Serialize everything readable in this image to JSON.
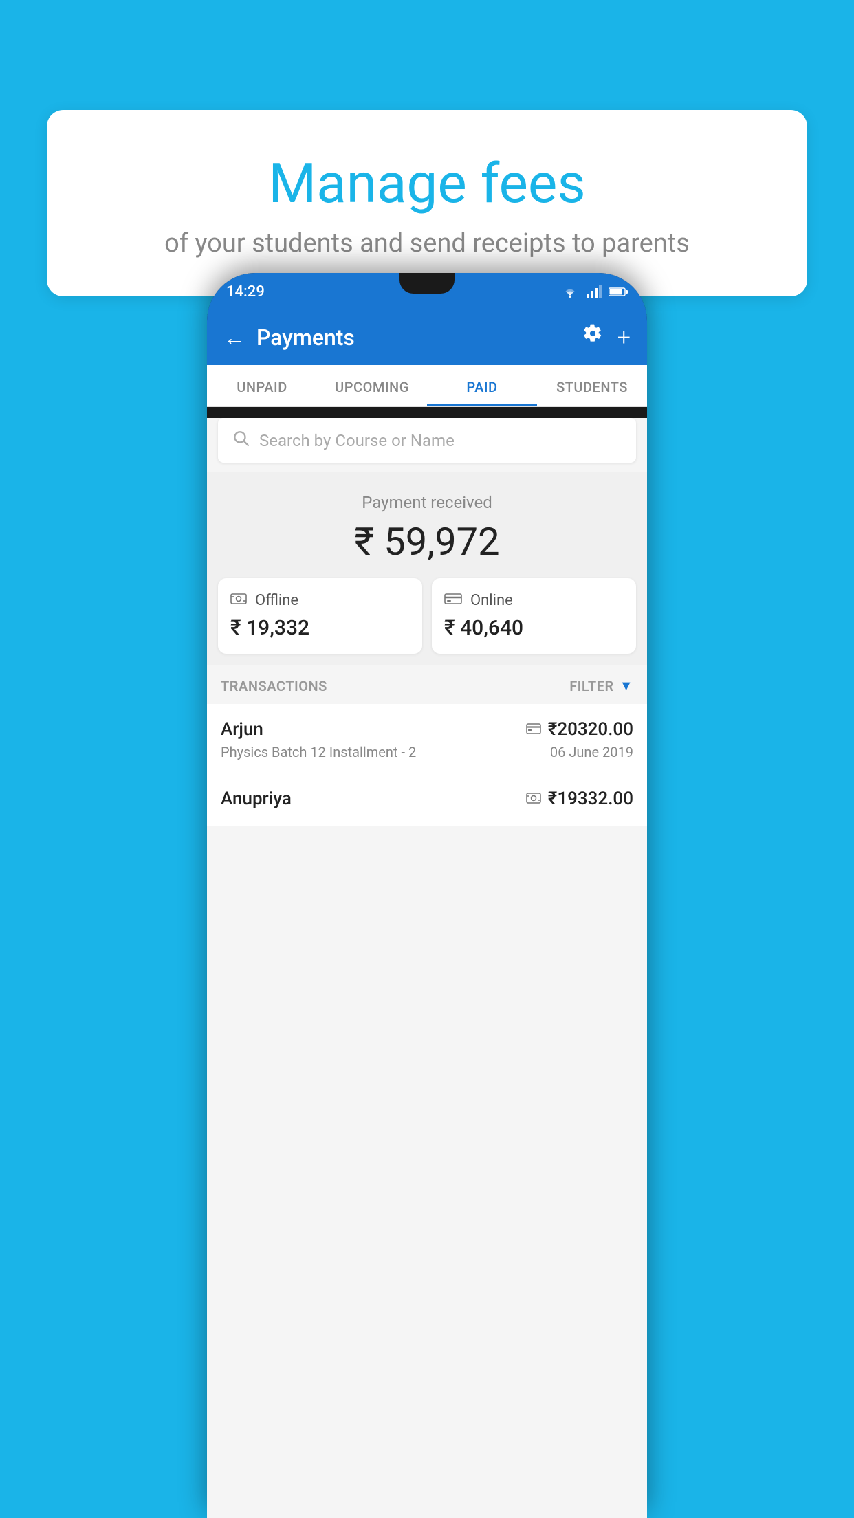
{
  "background_color": "#1ab4e8",
  "tooltip": {
    "title": "Manage fees",
    "subtitle": "of your students and send receipts to parents"
  },
  "status_bar": {
    "time": "14:29",
    "wifi": "▾",
    "signal": "▲",
    "battery": "▮"
  },
  "app_header": {
    "title": "Payments",
    "back_label": "←",
    "settings_label": "⚙",
    "add_label": "+"
  },
  "tabs": [
    {
      "id": "unpaid",
      "label": "UNPAID",
      "active": false
    },
    {
      "id": "upcoming",
      "label": "UPCOMING",
      "active": false
    },
    {
      "id": "paid",
      "label": "PAID",
      "active": true
    },
    {
      "id": "students",
      "label": "STUDENTS",
      "active": false
    }
  ],
  "search": {
    "placeholder": "Search by Course or Name"
  },
  "payment_received": {
    "label": "Payment received",
    "amount": "₹ 59,972"
  },
  "payment_cards": [
    {
      "id": "offline",
      "icon": "💳",
      "label": "Offline",
      "amount": "₹ 19,332"
    },
    {
      "id": "online",
      "icon": "💳",
      "label": "Online",
      "amount": "₹ 40,640"
    }
  ],
  "transactions_label": "TRANSACTIONS",
  "filter_label": "FILTER",
  "transactions": [
    {
      "name": "Arjun",
      "course": "Physics Batch 12 Installment - 2",
      "amount": "₹20320.00",
      "date": "06 June 2019",
      "type": "online"
    },
    {
      "name": "Anupriya",
      "course": "",
      "amount": "₹19332.00",
      "date": "",
      "type": "offline"
    }
  ]
}
